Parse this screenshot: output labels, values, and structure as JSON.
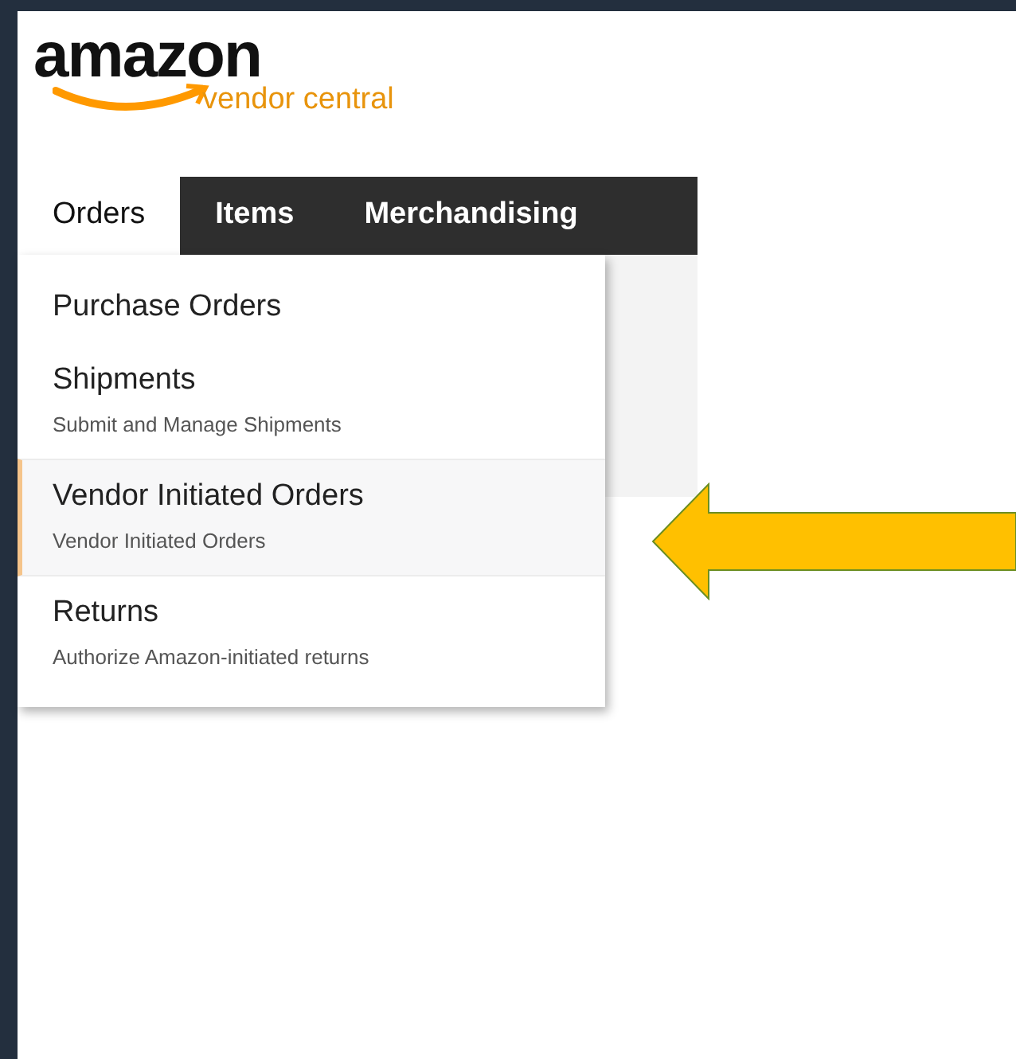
{
  "logo": {
    "wordmark": "amazon",
    "subtitle": "vendor central"
  },
  "tabs": [
    {
      "label": "Orders",
      "selected": true
    },
    {
      "label": "Items",
      "selected": false
    },
    {
      "label": "Merchandising",
      "selected": false
    }
  ],
  "menu": [
    {
      "title": "Purchase Orders",
      "selected": false
    },
    {
      "title": "Shipments",
      "subtitle": "Submit and Manage Shipments",
      "selected": false
    },
    {
      "title": "Vendor Initiated Orders",
      "subtitle": "Vendor Initiated Orders",
      "selected": true
    },
    {
      "title": "Returns",
      "subtitle": "Authorize Amazon-initiated returns",
      "selected": false
    }
  ],
  "annotation": {
    "kind": "arrow"
  }
}
